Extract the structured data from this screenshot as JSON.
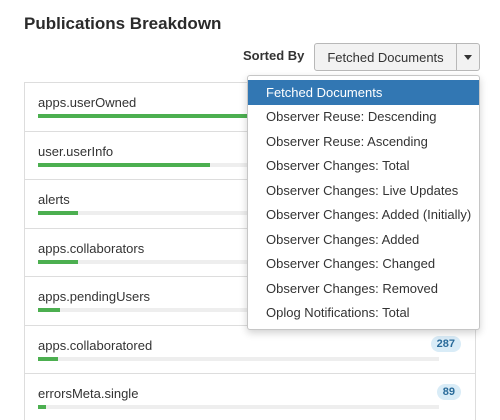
{
  "page": {
    "title": "Publications Breakdown"
  },
  "sort": {
    "label": "Sorted By",
    "selected": "Fetched Documents",
    "options": [
      "Fetched Documents",
      "Observer Reuse: Descending",
      "Observer Reuse: Ascending",
      "Observer Changes: Total",
      "Observer Changes: Live Updates",
      "Observer Changes: Added (Initially)",
      "Observer Changes: Added",
      "Observer Changes: Changed",
      "Observer Changes: Removed",
      "Oplog Notifications: Total"
    ]
  },
  "publications": [
    {
      "name": "apps.userOwned",
      "level": 0.6,
      "count": ""
    },
    {
      "name": "user.userInfo",
      "level": 0.43,
      "count": ""
    },
    {
      "name": "alerts",
      "level": 0.1,
      "count": ""
    },
    {
      "name": "apps.collaborators",
      "level": 0.1,
      "count": ""
    },
    {
      "name": "apps.pendingUsers",
      "level": 0.055,
      "count": ""
    },
    {
      "name": "apps.collaboratored",
      "level": 0.05,
      "count": "287"
    },
    {
      "name": "errorsMeta.single",
      "level": 0.02,
      "count": "89"
    }
  ],
  "colors": {
    "bar": "#4caf50",
    "selected_option": "#3277b3",
    "badge": "#d9ecf7"
  }
}
